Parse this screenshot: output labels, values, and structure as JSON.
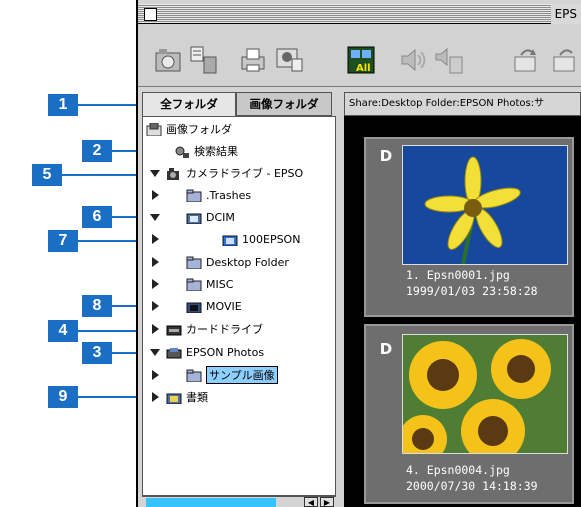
{
  "window": {
    "title": "EPS"
  },
  "tabs": {
    "all": "全フォルダ",
    "image": "画像フォルダ"
  },
  "path": "Share:Desktop Folder:EPSON Photos:サ",
  "tree": {
    "root": "画像フォルダ",
    "search": "検索結果",
    "camera": "カメラドライブ - EPSO",
    "trashes": ".Trashes",
    "dcim": "DCIM",
    "epson100": "100EPSON",
    "desktop": "Desktop Folder",
    "misc": "MISC",
    "movie": "MOVIE",
    "card": "カードドライブ",
    "photos": "EPSON Photos",
    "sample": "サンプル画像",
    "doc": "書類"
  },
  "thumbs": [
    {
      "badge": "D",
      "name": "1. Epsn0001.jpg",
      "date": "1999/01/03  23:58:28"
    },
    {
      "badge": "D",
      "name": "4. Epsn0004.jpg",
      "date": "2000/07/30  14:18:39"
    }
  ],
  "callouts": [
    "1",
    "2",
    "5",
    "6",
    "7",
    "8",
    "4",
    "3",
    "9"
  ],
  "colors": {
    "callout": "#1a6fc4",
    "selection": "#8ecfff"
  }
}
